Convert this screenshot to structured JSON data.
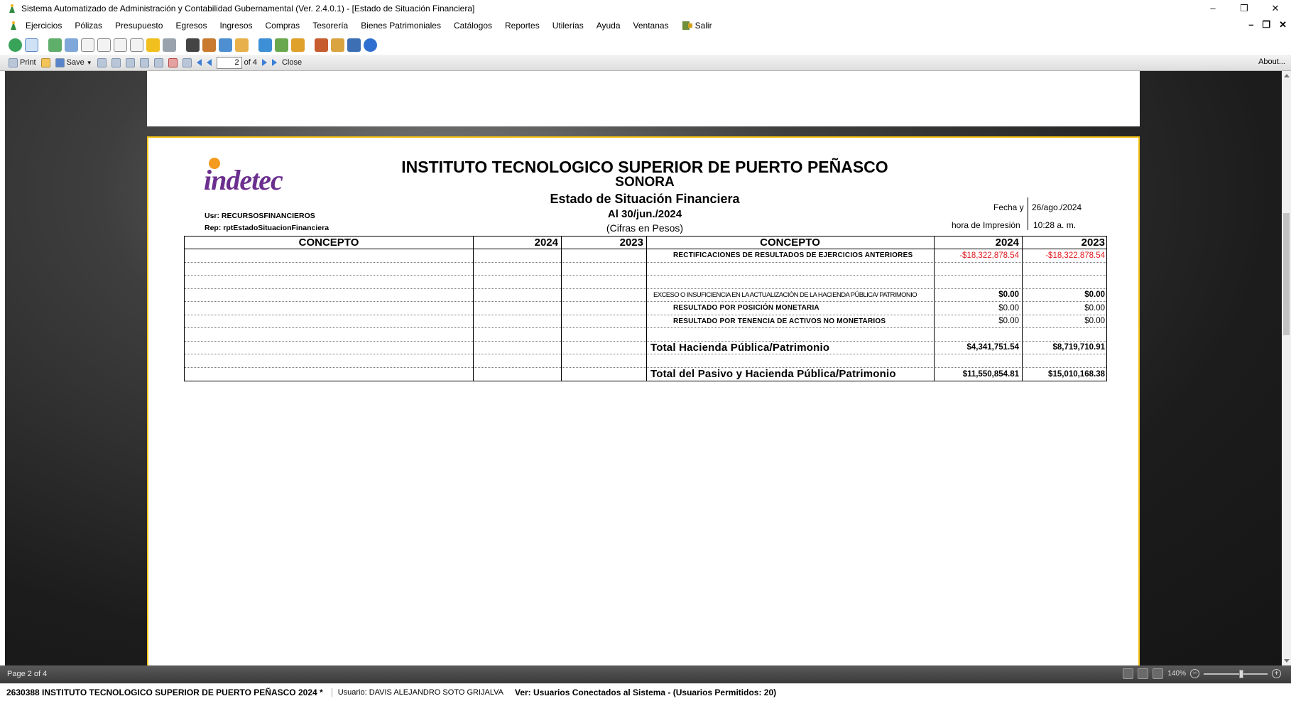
{
  "window": {
    "title": "Sistema Automatizado de Administración y Contabilidad Gubernamental  (Ver. 2.4.0.1) - [Estado de Situación Financiera]",
    "controls": {
      "minimize": "–",
      "restore": "❐",
      "close": "✕"
    }
  },
  "menu": {
    "items": [
      "Ejercicios",
      "Pólizas",
      "Presupuesto",
      "Egresos",
      "Ingresos",
      "Compras",
      "Tesorería",
      "Bienes Patrimoniales",
      "Catálogos",
      "Reportes",
      "Utilerías",
      "Ayuda",
      "Ventanas"
    ],
    "salir": "Salir",
    "child_controls": {
      "minimize": "–",
      "restore": "❐",
      "close": "✕"
    }
  },
  "preview_toolbar": {
    "print": "Print",
    "save": "Save",
    "page_value": "2",
    "page_of": "of 4",
    "close": "Close",
    "about": "About..."
  },
  "report": {
    "logo": "indetec",
    "institution": "INSTITUTO TECNOLOGICO SUPERIOR DE PUERTO PEÑASCO",
    "state": "SONORA",
    "statement": "Estado de Situación Financiera",
    "as_of": "Al 30/jun./2024",
    "units": "(Cifras en Pesos)",
    "user": "Usr: RECURSOSFINANCIEROS",
    "rep": "Rep: rptEstadoSituacionFinanciera",
    "fecha_label": "Fecha y",
    "fecha_value": "26/ago./2024",
    "hora_label": "hora de Impresión",
    "hora_value": "10:28 a. m.",
    "headers": {
      "left_concept": "CONCEPTO",
      "left_y1": "2024",
      "left_y2": "2023",
      "right_concept": "CONCEPTO",
      "right_y1": "2024",
      "right_y2": "2023"
    },
    "rows": [
      {
        "concept": "RECTIFICACIONES DE RESULTADOS DE EJERCICIOS ANTERIORES",
        "v2024": "-$18,322,878.54",
        "v2023": "-$18,322,878.54",
        "red": true,
        "style": "ind"
      },
      {
        "concept": "",
        "v2024": "",
        "v2023": ""
      },
      {
        "concept": "",
        "v2024": "",
        "v2023": ""
      },
      {
        "concept": "EXCESO O INSUFICIENCIA EN LA ACTUALIZACIÓN DE LA HACIENDA PÚBLICA/ PATRIMONIO",
        "v2024": "$0.00",
        "v2023": "$0.00",
        "bold": true,
        "style": "cond"
      },
      {
        "concept": "RESULTADO POR POSICIÓN MONETARIA",
        "v2024": "$0.00",
        "v2023": "$0.00",
        "style": "ind"
      },
      {
        "concept": "RESULTADO POR TENENCIA DE ACTIVOS NO MONETARIOS",
        "v2024": "$0.00",
        "v2023": "$0.00",
        "style": "ind"
      },
      {
        "concept": "",
        "v2024": "",
        "v2023": ""
      },
      {
        "concept": "Total Hacienda Pública/Patrimonio",
        "v2024": "$4,341,751.54",
        "v2023": "$8,719,710.91",
        "bold": true,
        "style": "big"
      },
      {
        "concept": "",
        "v2024": "",
        "v2023": ""
      },
      {
        "concept": "Total del Pasivo y Hacienda Pública/Patrimonio",
        "v2024": "$11,550,854.81",
        "v2023": "$15,010,168.38",
        "bold": true,
        "style": "big"
      }
    ]
  },
  "preview_status": {
    "page": "Page 2 of 4",
    "zoom": "140%"
  },
  "status_bar": {
    "entity": "2630388 INSTITUTO TECNOLOGICO SUPERIOR DE PUERTO PEÑASCO  2024  *",
    "user": "Usuario: DAVIS ALEJANDRO SOTO GRIJALVA",
    "connected": "Ver: Usuarios Conectados al Sistema - (Usuarios Permitidos: 20)"
  },
  "colors": {
    "accent_logo": "#6b2f8f",
    "logo_dot": "#f49a1f",
    "negative": "#e0191e",
    "page_border": "#f5c518"
  }
}
